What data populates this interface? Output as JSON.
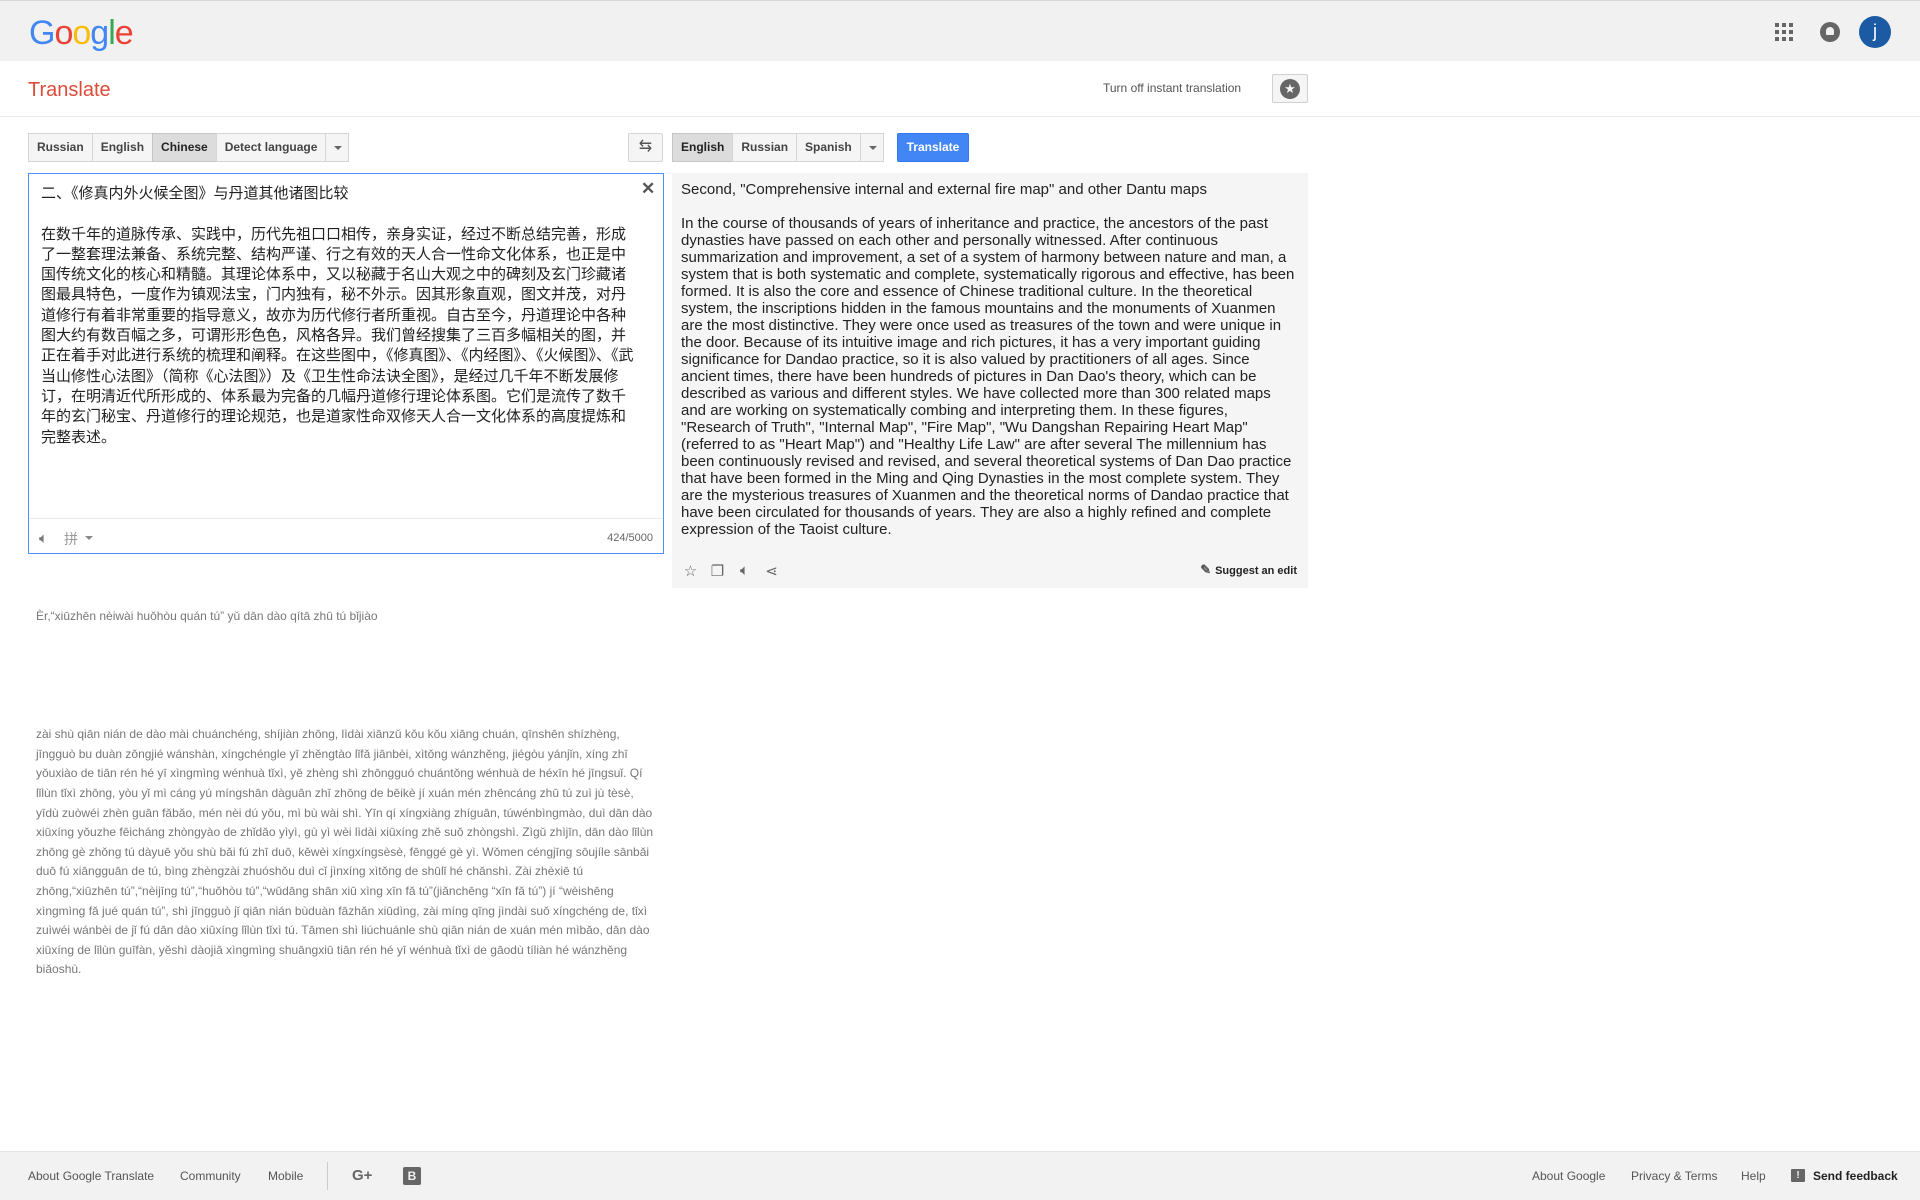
{
  "header": {
    "logo": [
      "G",
      "o",
      "o",
      "g",
      "l",
      "e"
    ],
    "avatar_letter": "j",
    "icons": [
      "apps-icon",
      "notifications-icon",
      "account-avatar"
    ]
  },
  "subheader": {
    "title": "Translate",
    "instant_link": "Turn off instant translation",
    "star_icon": "star-icon"
  },
  "source_langs": [
    {
      "label": "Russian",
      "selected": false
    },
    {
      "label": "English",
      "selected": false
    },
    {
      "label": "Chinese",
      "selected": true
    },
    {
      "label": "Detect language",
      "selected": false
    }
  ],
  "target_langs": [
    {
      "label": "English",
      "selected": true
    },
    {
      "label": "Russian",
      "selected": false
    },
    {
      "label": "Spanish",
      "selected": false
    }
  ],
  "swap_icon": "swap-arrows-icon",
  "translate_label": "Translate",
  "source": {
    "text": "二、《修真内外火候全图》与丹道其他诸图比较\n\n在数千年的道脉传承、实践中，历代先祖口口相传，亲身实证，经过不断总结完善，形成了一整套理法兼备、系统完整、结构严谨、行之有效的天人合一性命文化体系，也正是中国传统文化的核心和精髓。其理论体系中，又以秘藏于名山大观之中的碑刻及玄门珍藏诸图最具特色，一度作为镇观法宝，门内独有，秘不外示。因其形象直观，图文并茂，对丹道修行有着非常重要的指导意义，故亦为历代修行者所重视。自古至今，丹道理论中各种图大约有数百幅之多，可谓形形色色，风格各异。我们曾经搜集了三百多幅相关的图，并正在着手对此进行系统的梳理和阐释。在这些图中，《修真图》、《内经图》、《火候图》、《武当山修性心法图》（简称《心法图》）及《卫生性命法诀全图》，是经过几千年不断发展修订，在明清近代所形成的、体系最为完备的几幅丹道修行理论体系图。它们是流传了数千年的玄门秘宝、丹道修行的理论规范，也是道家性命双修天人合一文化体系的高度提炼和完整表述。",
    "char_count": "424/5000",
    "pinyin_glyph": "拼"
  },
  "transliteration": {
    "title_line": "Èr,“xiūzhēn nèiwài huǒhòu quán tú” yǔ dān dào qítā zhū tú bǐjiào",
    "body": "zài shù qiān nián de dào mài chuánchéng, shíjiàn zhōng, lìdài xiānzǔ kǒu kǒu xiāng chuán, qīnshēn shízhèng, jīngguò bu duàn zǒngjié wánshàn, xíngchéngle yī zhěngtào lǐfǎ jiānbèi, xìtǒng wánzhěng, jiégòu yánjǐn, xíng zhī yǒuxiào de tiān rén hé yī xìngmìng wénhuà tǐxì, yě zhèng shì zhōngguó chuántǒng wénhuà de héxīn hé jīngsuǐ. Qí lǐlùn tǐxì zhōng, yòu yǐ mì cáng yú míngshān dàguān zhī zhōng de bēikè jí xuán mén zhēncáng zhū tú zuì jù tèsè, yīdù zuòwéi zhèn guān fǎbǎo, mén nèi dú yǒu, mì bù wài shì. Yīn qí xíngxiàng zhíguān, túwénbìngmào, duì dān dào xiūxíng yǒuzhe fēicháng zhòngyào de zhǐdǎo yìyì, gù yì wèi lìdài xiūxíng zhě suǒ zhòngshì. Zìgǔ zhìjīn, dān dào lǐlùn zhōng gè zhǒng tú dàyuē yǒu shù bǎi fú zhī duō, kěwèi xíngxíngsèsè, fēnggé gè yì. Wǒmen céngjīng sōujíle sānbǎi duō fú xiāngguān de tú, bìng zhèngzài zhuóshǒu duì cǐ jìnxíng xìtǒng de shūlǐ hé chǎnshì. Zài zhèxiē tú zhōng,“xiūzhēn tú”,“nèijīng tú”,“huǒhòu tú”,“wǔdāng shān xiū xìng xīn fǎ tú”(jiǎnchēng “xīn fǎ tú”) jí “wèishēng xìngmìng fǎ jué quán tú”, shì jīngguò jǐ qiān nián bùduàn fāzhǎn xiūdìng, zài míng qīng jìndài suǒ xíngchéng de, tǐxì zuìwéi wánbèi de jǐ fú dān dào xiūxíng lǐlùn tǐxì tú. Tāmen shì liúchuánle shù qiān nián de xuán mén mìbǎo, dān dào xiūxíng de lǐlùn guīfàn, yěshì dàojiā xìngmìng shuāngxiū tiān rén hé yī wénhuà tǐxì de gāodù tíliàn hé wánzhěng biǎoshù."
  },
  "result": {
    "text": "Second, \"Comprehensive internal and external fire map\" and other Dantu maps\n\nIn the course of thousands of years of inheritance and practice, the ancestors of the past dynasties have passed on each other and personally witnessed. After continuous summarization and improvement, a set of a system of harmony between nature and man, a system that is both systematic and complete, systematically rigorous and effective, has been formed. It is also the core and essence of Chinese traditional culture. In the theoretical system, the inscriptions hidden in the famous mountains and the monuments of Xuanmen are the most distinctive. They were once used as treasures of the town and were unique in the door. Because of its intuitive image and rich pictures, it has a very important guiding significance for Dandao practice, so it is also valued by practitioners of all ages. Since ancient times, there have been hundreds of pictures in Dan Dao's theory, which can be described as various and different styles. We have collected more than 300 related maps and are working on systematically combing and interpreting them. In these figures, \"Research of Truth\", \"Internal Map\", \"Fire Map\", \"Wu Dangshan Repairing Heart Map\" (referred to as \"Heart Map\") and \"Healthy Life Law\" are after several The millennium has been continuously revised and revised, and several theoretical systems of Dan Dao practice that have been formed in the Ming and Qing Dynasties in the most complete system. They are the mysterious treasures of Xuanmen and the theoretical norms of Dandao practice that have been circulated for thousands of years. They are also a highly refined and complete expression of the Taoist culture.",
    "suggest_edit": "Suggest an edit",
    "tool_icons": [
      "star-outline-icon",
      "copy-icon",
      "speaker-icon",
      "share-icon"
    ]
  },
  "footer": {
    "about_translate": "About Google Translate",
    "community": "Community",
    "mobile": "Mobile",
    "about_google": "About Google",
    "privacy_terms": "Privacy & Terms",
    "help": "Help",
    "send_feedback": "Send feedback"
  }
}
